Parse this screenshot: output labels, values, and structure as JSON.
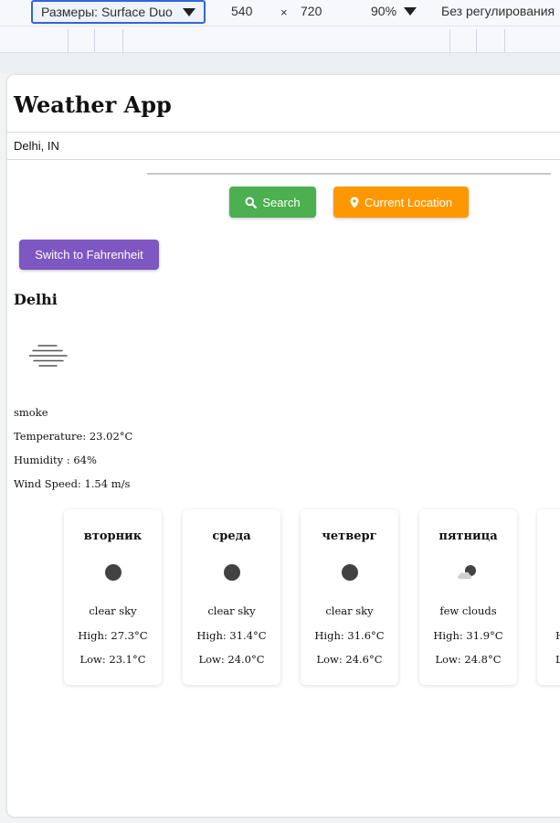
{
  "devtools": {
    "device_label": "Размеры: Surface Duo",
    "width": "540",
    "times": "×",
    "height": "720",
    "zoom": "90%",
    "throttling": "Без регулирования"
  },
  "app": {
    "title": "Weather App",
    "city_input_value": "Delhi, IN",
    "search_label": "Search",
    "location_label": "Current Location",
    "switch_label": "Switch to Fahrenheit"
  },
  "current": {
    "city": "Delhi",
    "icon": "smoke-icon",
    "description": "smoke",
    "temperature": "Temperature: 23.02°C",
    "humidity": "Humidity : 64%",
    "wind": "Wind Speed: 1.54 m/s"
  },
  "forecast": [
    {
      "day": "вторник",
      "icon": "clear-sky-icon",
      "desc": "clear sky",
      "high": "High: 27.3°C",
      "low": "Low: 23.1°C"
    },
    {
      "day": "среда",
      "icon": "clear-sky-icon",
      "desc": "clear sky",
      "high": "High: 31.4°C",
      "low": "Low: 24.0°C"
    },
    {
      "day": "четверг",
      "icon": "clear-sky-icon",
      "desc": "clear sky",
      "high": "High: 31.6°C",
      "low": "Low: 24.6°C"
    },
    {
      "day": "пятница",
      "icon": "few-clouds-icon",
      "desc": "few clouds",
      "high": "High: 31.9°C",
      "low": "Low: 24.8°C"
    },
    {
      "day": "",
      "icon": "",
      "desc": "",
      "high": "H",
      "low": "L"
    }
  ],
  "colors": {
    "search": "#4caf50",
    "location": "#ff9800",
    "switch": "#7e57c2",
    "select_border": "#3166d8"
  }
}
